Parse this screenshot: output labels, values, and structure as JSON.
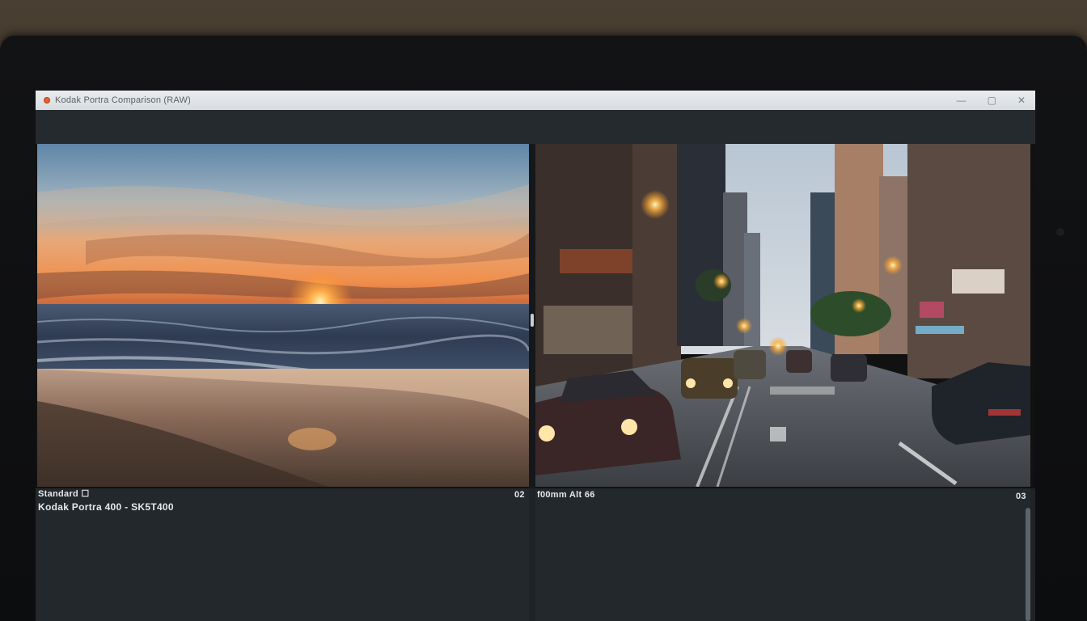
{
  "window": {
    "title": "Kodak Portra Comparison (RAW)",
    "controls": {
      "minimize": "—",
      "maximize": "▢",
      "close": "✕"
    }
  },
  "panels": {
    "left": {
      "tag": "Standard ☐",
      "film": "Kodak Portra 400 - SK5T400",
      "counter": "02"
    },
    "right": {
      "film": "f00mm Alt 66",
      "counter": "03"
    }
  },
  "colors": {
    "accent": "#e0622e",
    "title_bar": "#dfe3e7",
    "window_bg": "#1f2327",
    "info_bg": "#23282d",
    "text": "#e6e9ec"
  }
}
